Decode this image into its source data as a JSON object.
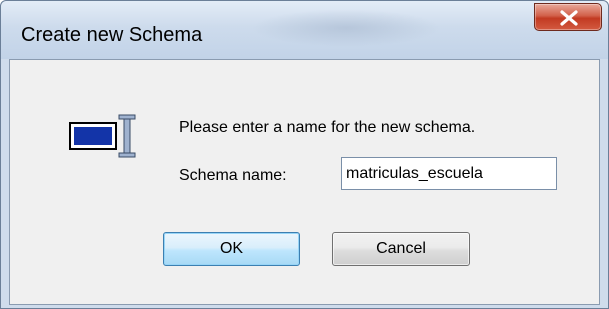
{
  "window": {
    "title": "Create new Schema"
  },
  "icons": {
    "close": "close-icon",
    "schema": "schema-text-cursor-icon"
  },
  "dialog": {
    "prompt": "Please enter a name for the new schema.",
    "name_label": "Schema name:",
    "name_value": "matriculas_escuela"
  },
  "buttons": {
    "ok_label": "OK",
    "cancel_label": "Cancel"
  },
  "colors": {
    "title_bar": "#cddbec",
    "close_button": "#c8452e",
    "ok_button_border": "#3c7fb1",
    "dialog_background": "#f0f0f0"
  }
}
